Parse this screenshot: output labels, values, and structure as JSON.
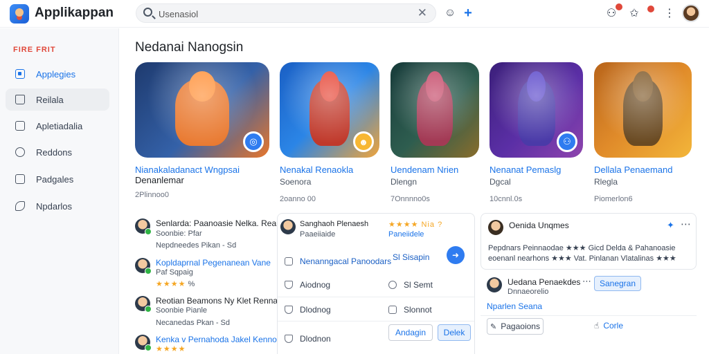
{
  "app": {
    "title": "Applikappan"
  },
  "search": {
    "value": "Usenasiol",
    "clear": "✕"
  },
  "topbar": {
    "smile_icon": "☺",
    "plus_icon": "+",
    "bell_icon": "⚇",
    "pin_icon": "✩",
    "more_icon": "⋮"
  },
  "sidebar": {
    "section": "FIRE FRIT",
    "items": [
      {
        "label": "Applegies",
        "icon": "square-icon"
      },
      {
        "label": "Reilala",
        "icon": "home-icon"
      },
      {
        "label": "Apletiadalia",
        "icon": "doc-icon"
      },
      {
        "label": "Reddons",
        "icon": "gear-icon"
      },
      {
        "label": "Padgales",
        "icon": "chart-icon"
      },
      {
        "label": "Npdarlos",
        "icon": "leaf-icon"
      }
    ]
  },
  "main": {
    "title": "Nedanai Nanogsin",
    "games": [
      {
        "name": "Nianakaladanact Wngpsai",
        "name2": "Denanlemar",
        "sub": "",
        "meta": "2Plinnoo0",
        "colors": [
          "#1e3a6e",
          "#e8762b"
        ],
        "fab": "◎"
      },
      {
        "name": "Nenakal Renaokla",
        "name2": "",
        "sub": "Soenora",
        "meta": "2oanno 00",
        "colors": [
          "#1a5fc4",
          "#c0392b"
        ],
        "fab": "☻"
      },
      {
        "name": "Uendenam Nrien",
        "name2": "",
        "sub": "Dlengn",
        "meta": "7Onnnno0s",
        "colors": [
          "#173b3a",
          "#8a6d2b"
        ],
        "fab": ""
      },
      {
        "name": "Nenanat Pemaslg",
        "name2": "",
        "sub": "Dgcal",
        "meta": "10cnnl.0s",
        "colors": [
          "#3b1f7a",
          "#8e44ad"
        ],
        "fab": "⚇"
      },
      {
        "name": "Dellala Penaemand",
        "name2": "",
        "sub": "Rlegla",
        "meta": "Piomerlon6",
        "colors": [
          "#b8641a",
          "#f3b63a"
        ],
        "fab": ""
      }
    ]
  },
  "feed": {
    "posts": [
      {
        "title": "Senlarda: Paanoasie Nelka. Rean",
        "line1": "Soonbie: Pfar",
        "line2": "Nepdneedes Pikan - Sd"
      },
      {
        "title": "Kopldaprnal Pegenanean Vane",
        "line1": "Paf Sqpaig",
        "stars": "★★★★",
        "line2": "% "
      },
      {
        "title": "Reotian Beamons  Ny Klet Renna",
        "line1": "Soonbie Pianle",
        "line2": "Necanedas Pkan - Sd"
      },
      {
        "title": "Kenka v Pernahoda  Jakel Kenno",
        "line1": "",
        "stars": "★★★★",
        "line2": ""
      }
    ],
    "middle": {
      "header_title": "Sanghaoh Plenaesh",
      "header_sub": "Paaeiiaide",
      "header_right": "★★★★  Nia ?",
      "header_link": "Paneiidele",
      "rows": [
        {
          "left": "Nenanngacal Panoodars",
          "right": "Sl Sisapin"
        },
        {
          "left": "Aiodnog",
          "right": "Sl Semt"
        },
        {
          "left": "Dlodnog",
          "right": "Slonnot"
        },
        {
          "left": "Dlodnon",
          "right": ""
        }
      ],
      "btn_outline": "Andagin",
      "btn_fill": "Delek"
    },
    "right": {
      "name": "Oenida Unqmes",
      "body1": "Pepdnars Peinnaodae ★★★ Gicd Delda & Pahanoasie",
      "body2": "eoenanl nearhons ★★★ Vat. Pinlanan Vlatalinas ★★★",
      "name2": "Uedana Penaekdes",
      "sub2": "Dnnaeorelio",
      "btn2": "Sanegran",
      "link": "Nparlen Seana",
      "act1": "Pagaoions",
      "act2": "Corle"
    }
  }
}
